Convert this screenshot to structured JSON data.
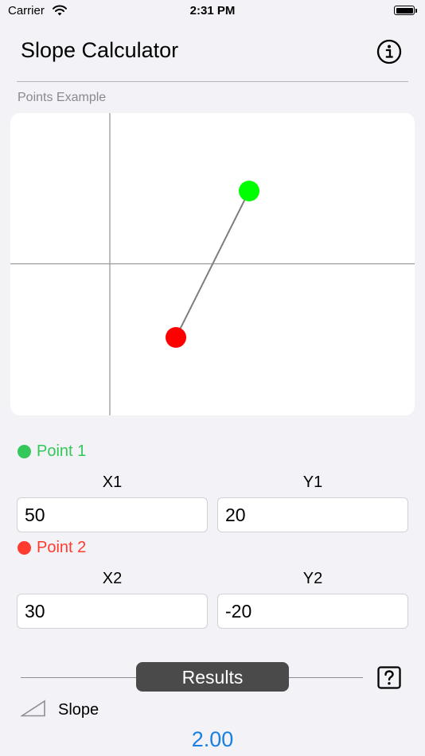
{
  "status_bar": {
    "carrier": "Carrier",
    "time": "2:31 PM"
  },
  "header": {
    "title": "Slope Calculator"
  },
  "graph": {
    "label": "Points Example",
    "point1_color": "#00ff00",
    "point2_color": "#ff0000"
  },
  "point1": {
    "heading": "Point 1",
    "x_label": "X1",
    "y_label": "Y1",
    "x_value": "50",
    "y_value": "20",
    "color": "#34c759"
  },
  "point2": {
    "heading": "Point 2",
    "x_label": "X2",
    "y_label": "Y2",
    "x_value": "30",
    "y_value": "-20",
    "color": "#ff3b30"
  },
  "results": {
    "button_label": "Results",
    "slope_label": "Slope",
    "slope_value": "2.00",
    "value_color": "#1a7fe0"
  },
  "icons": {
    "info": "info-icon",
    "help": "question-mark-icon",
    "slope": "slope-triangle-icon",
    "wifi": "wifi-icon",
    "battery": "battery-icon"
  }
}
